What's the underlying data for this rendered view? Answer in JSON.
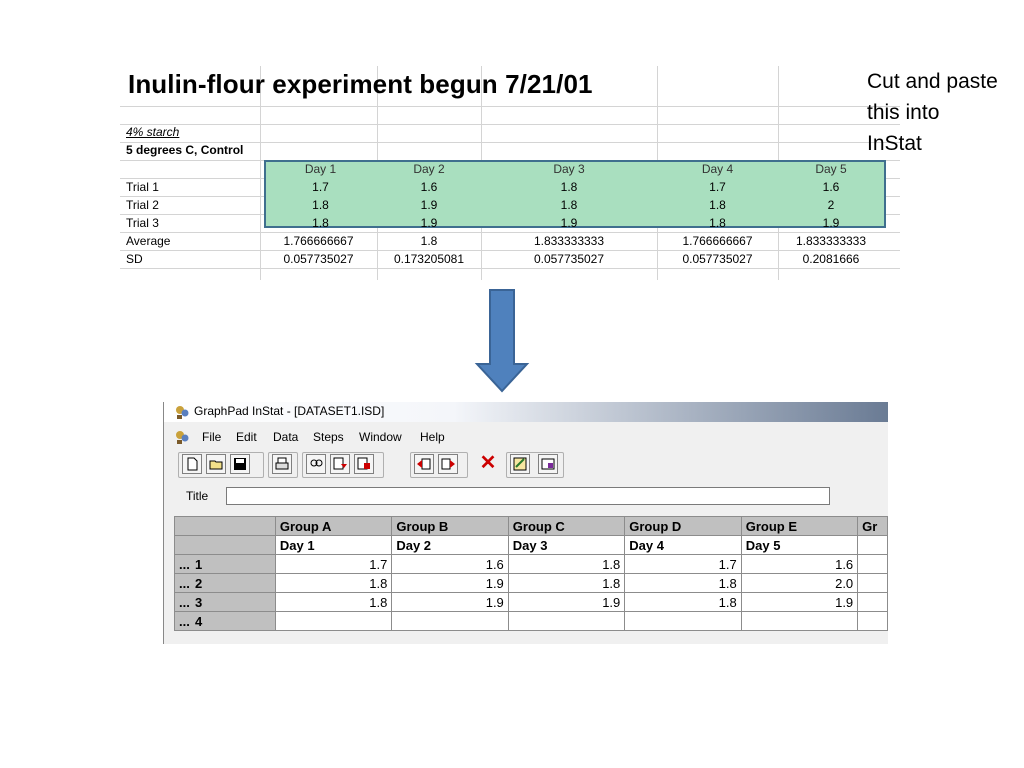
{
  "spreadsheet": {
    "title": "Inulin-flour experiment begun 7/21/01",
    "subtitle1": "4% starch",
    "subtitle2": "5 degrees C, Control",
    "columns": [
      "Day 1",
      "Day 2",
      "Day 3",
      "Day 4",
      "Day 5"
    ],
    "rows": [
      {
        "label": "Trial 1",
        "values": [
          "1.7",
          "1.6",
          "1.8",
          "1.7",
          "1.6"
        ]
      },
      {
        "label": "Trial 2",
        "values": [
          "1.8",
          "1.9",
          "1.8",
          "1.8",
          "2"
        ]
      },
      {
        "label": "Trial 3",
        "values": [
          "1.8",
          "1.9",
          "1.9",
          "1.8",
          "1.9"
        ]
      }
    ],
    "average": {
      "label": "Average",
      "values": [
        "1.766666667",
        "1.8",
        "1.833333333",
        "1.766666667",
        "1.833333333"
      ]
    },
    "sd": {
      "label": "SD",
      "values": [
        "0.057735027",
        "0.173205081",
        "0.057735027",
        "0.057735027",
        "0.2081666"
      ]
    },
    "highlight_color": "#a9dfbf",
    "highlight_border": "#3f6f8e"
  },
  "callout": {
    "line1": "Cut and paste",
    "line2": "this into",
    "line3": "InStat"
  },
  "arrow": {
    "color": "#4f81bd",
    "icon": "down-arrow"
  },
  "instat": {
    "window_title": "GraphPad InStat - [DATASET1.ISD]",
    "menus": [
      "File",
      "Edit",
      "Data",
      "Steps",
      "Window",
      "Help"
    ],
    "title_label": "Title",
    "title_value": "",
    "group_headers": [
      "Group A",
      "Group B",
      "Group C",
      "Group D",
      "Group E",
      "Gr"
    ],
    "column_titles": [
      "Day 1",
      "Day 2",
      "Day 3",
      "Day 4",
      "Day 5",
      ""
    ],
    "row_dots": "...",
    "rows": [
      {
        "num": "1",
        "values": [
          "1.7",
          "1.6",
          "1.8",
          "1.7",
          "1.6",
          ""
        ]
      },
      {
        "num": "2",
        "values": [
          "1.8",
          "1.9",
          "1.8",
          "1.8",
          "2.0",
          ""
        ]
      },
      {
        "num": "3",
        "values": [
          "1.8",
          "1.9",
          "1.9",
          "1.8",
          "1.9",
          ""
        ]
      },
      {
        "num": "4",
        "values": [
          "",
          "",
          "",
          "",
          "",
          ""
        ]
      }
    ]
  }
}
